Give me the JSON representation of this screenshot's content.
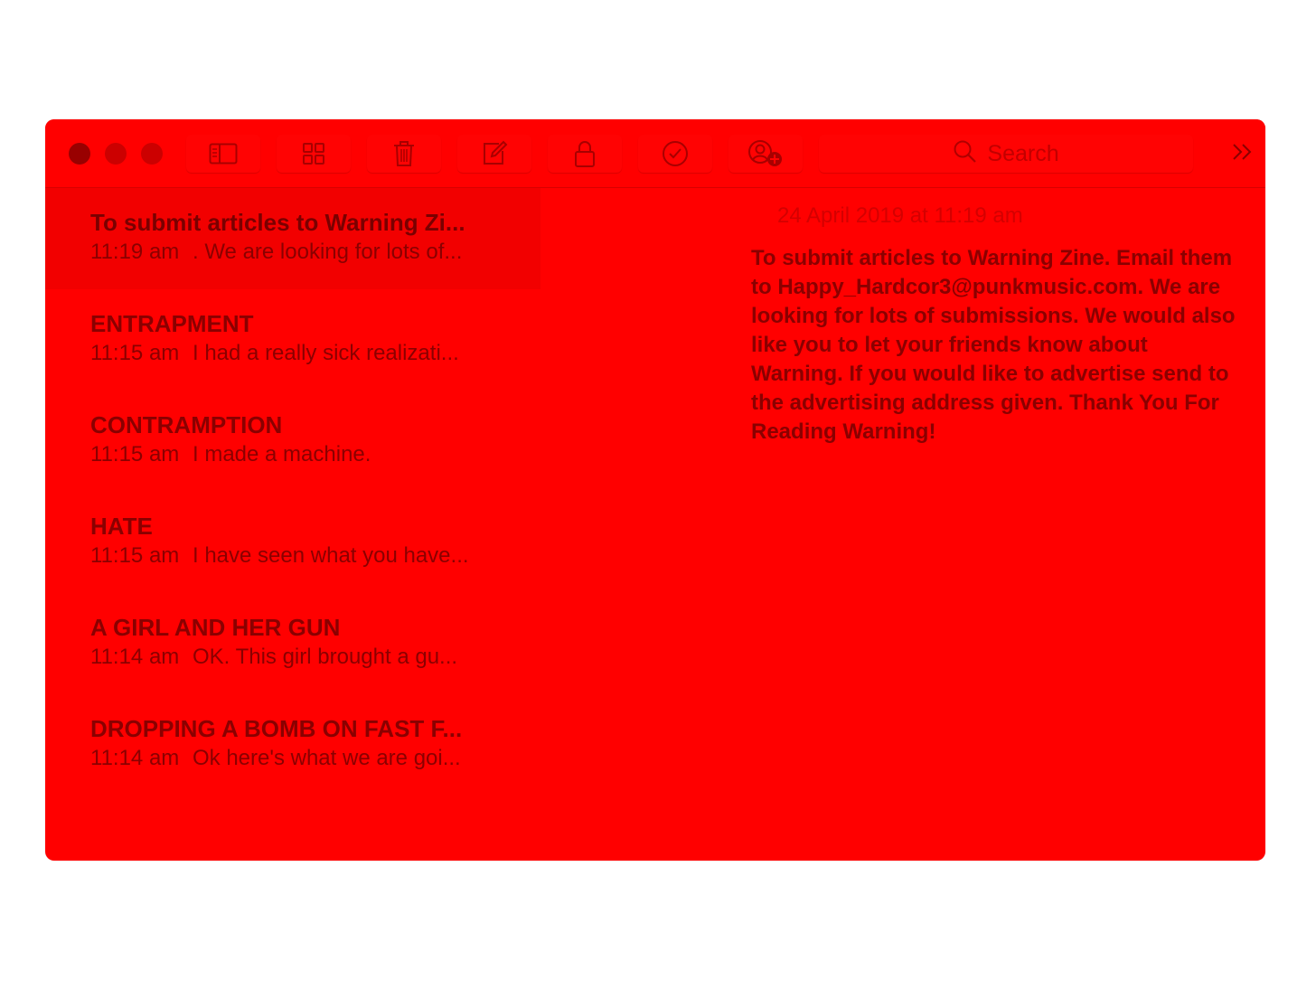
{
  "toolbar": {
    "buttons": [
      {
        "name": "sidebar-toggle",
        "icon": "sidebar-icon"
      },
      {
        "name": "attachments",
        "icon": "grid-icon"
      },
      {
        "name": "delete",
        "icon": "trash-icon"
      },
      {
        "name": "new-note",
        "icon": "compose-icon"
      },
      {
        "name": "lock",
        "icon": "lock-icon"
      },
      {
        "name": "checklist",
        "icon": "checkmark-circle-icon"
      },
      {
        "name": "add-people",
        "icon": "add-person-icon"
      }
    ],
    "search_placeholder": "Search",
    "overflow_icon": "double-chevron-right-icon"
  },
  "notes": [
    {
      "title": "To submit articles to Warning Zi...",
      "time": "11:19 am",
      "snippet": ". We are looking for lots of...",
      "selected": true
    },
    {
      "title": "ENTRAPMENT",
      "time": "11:15 am",
      "snippet": "I had a really sick realizati...",
      "selected": false
    },
    {
      "title": "CONTRAMPTION",
      "time": "11:15 am",
      "snippet": "I made a machine.",
      "selected": false
    },
    {
      "title": "HATE",
      "time": "11:15 am",
      "snippet": "I have seen what you have...",
      "selected": false
    },
    {
      "title": "A GIRL AND HER GUN",
      "time": "11:14 am",
      "snippet": "OK. This girl brought a gu...",
      "selected": false
    },
    {
      "title": "DROPPING A BOMB ON FAST F...",
      "time": "11:14 am",
      "snippet": "Ok here's what we are goi...",
      "selected": false
    }
  ],
  "editor": {
    "date": "24 April 2019 at 11:19 am",
    "body": "To submit articles to Warning Zine. Email them to Happy_Hardcor3@punkmusic.com. We are looking for lots of submissions. We would also like you to let your friends know about Warning. If you would like to advertise send to the advertising address given. Thank You For Reading Warning!"
  },
  "colors": {
    "window_bg": "#ff0000",
    "text_dark": "#8a0000",
    "text_faint": "#d40000"
  }
}
